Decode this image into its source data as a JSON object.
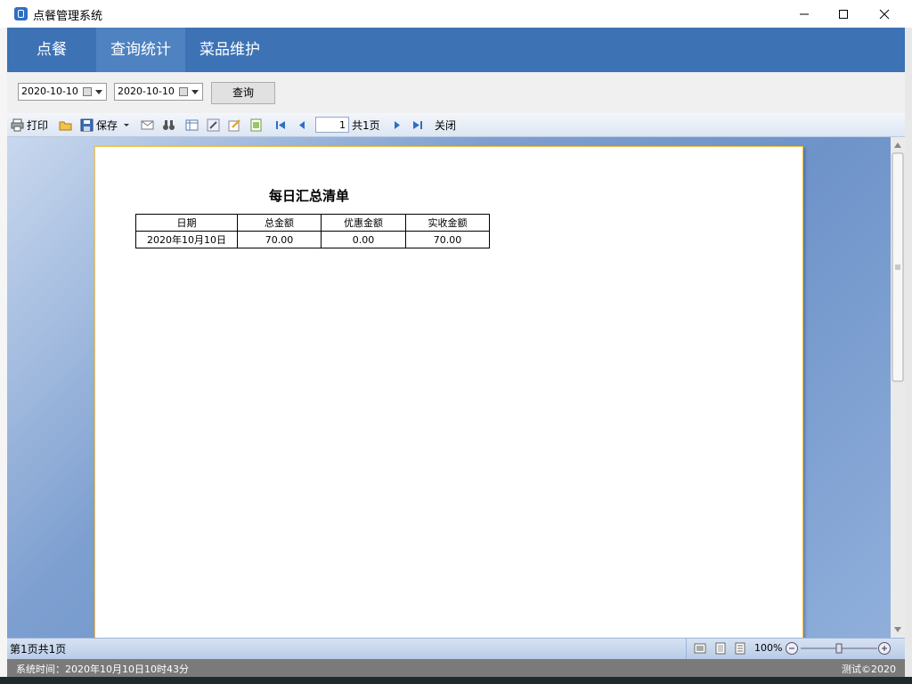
{
  "window": {
    "title": "点餐管理系统",
    "controls": [
      "minimize-icon",
      "maximize-icon",
      "close-icon"
    ]
  },
  "menu": {
    "items": [
      {
        "label": "点餐",
        "active": false
      },
      {
        "label": "查询统计",
        "active": true
      },
      {
        "label": "菜品维护",
        "active": false
      }
    ]
  },
  "query": {
    "start_date": "2020-10-10",
    "end_date": "2020-10-10",
    "query_label": "查询"
  },
  "toolbar": {
    "print_label": "打印",
    "save_label": "保存",
    "page_input": "1",
    "page_total": "共1页",
    "close_label": "关闭"
  },
  "report": {
    "title": "每日汇总清单",
    "headers": [
      "日期",
      "总金额",
      "优惠金额",
      "实收金额"
    ],
    "rows": [
      [
        "2020年10月10日",
        "70.00",
        "0.00",
        "70.00"
      ]
    ]
  },
  "viewer_status": {
    "page_info": "第1页共1页",
    "zoom": "100%"
  },
  "app_status": {
    "time_text": "系统时间：2020年10月10日10时43分",
    "copyright": "测试©2020"
  },
  "colors": {
    "menu_bg": "#3d72b5",
    "menu_active": "#4f82c0",
    "page_border": "#f0c040"
  }
}
